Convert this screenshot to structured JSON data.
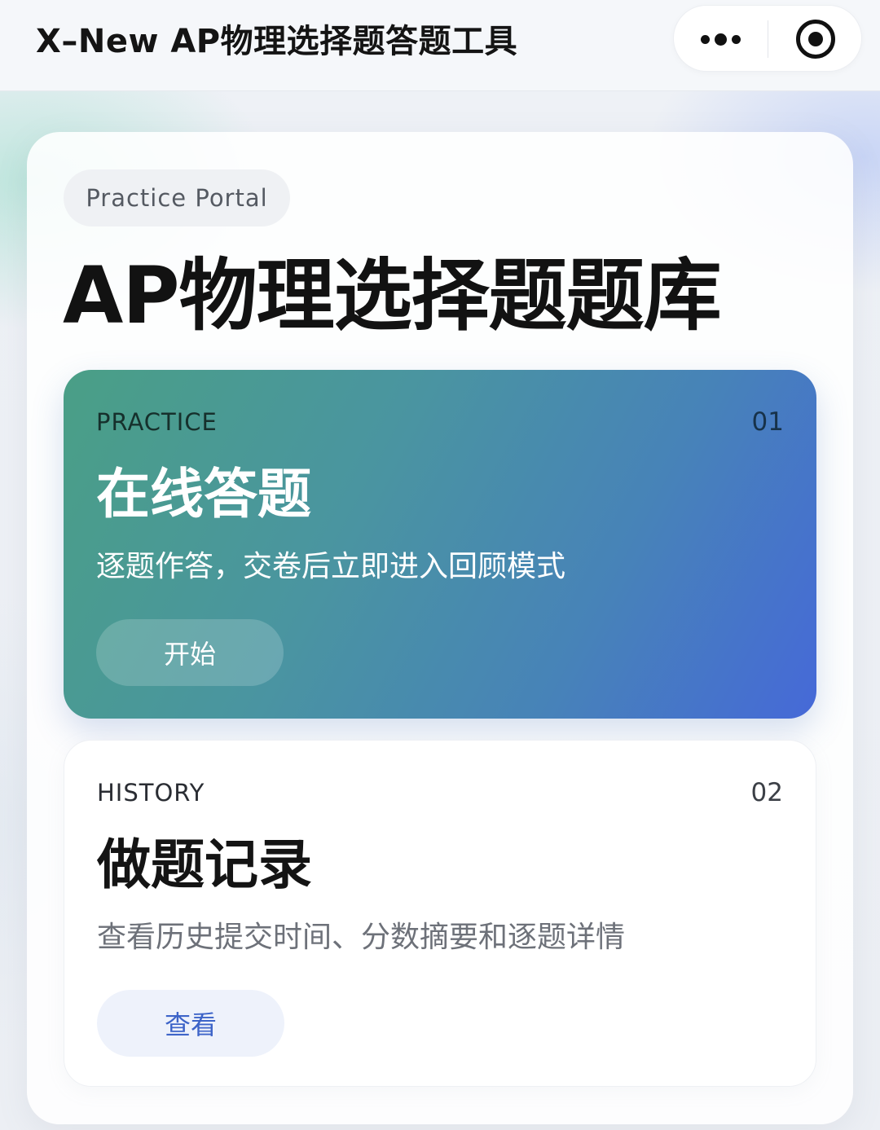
{
  "navbar": {
    "title": "X–New AP物理选择题答题工具",
    "more_icon": "more-dots-icon",
    "close_icon": "record-circle-icon"
  },
  "main": {
    "portal_label": "Practice Portal",
    "title": "AP物理选择题题库",
    "cards": [
      {
        "tag": "PRACTICE",
        "index": "01",
        "title": "在线答题",
        "description": "逐题作答，交卷后立即进入回顾模式",
        "button_label": "开始"
      },
      {
        "tag": "HISTORY",
        "index": "02",
        "title": "做题记录",
        "description": "查看历史提交时间、分数摘要和逐题详情",
        "button_label": "查看"
      }
    ]
  },
  "colors": {
    "practice_gradient_start": "#4a9f86",
    "practice_gradient_end": "#4669d8",
    "history_button_text": "#3d64c8",
    "history_button_bg": "#eef2fb"
  }
}
